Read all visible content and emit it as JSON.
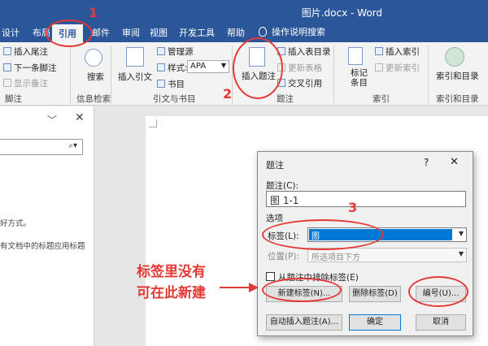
{
  "window": {
    "title": "图片.docx  -  Word"
  },
  "tabs": [
    "设计",
    "布局",
    "引用",
    "邮件",
    "审阅",
    "视图",
    "开发工具",
    "帮助"
  ],
  "tell_me": "操作说明搜索",
  "ribbon": {
    "footnotes": {
      "insert_endnote": "插入尾注",
      "next_footnote": "下一条脚注",
      "show_notes": "显示备注",
      "group": "脚注"
    },
    "research": {
      "search": "搜索",
      "group": "信息检索"
    },
    "citations": {
      "insert_citation": "插入引文",
      "manage_sources": "管理源",
      "style_label": "样式:",
      "style_value": "APA",
      "bibliography": "书目",
      "group": "引文与书目"
    },
    "captions": {
      "insert_caption": "插入题注",
      "insert_table_of_figures": "插入表目录",
      "update_table": "更新表格",
      "cross_reference": "交叉引用",
      "group": "题注"
    },
    "index": {
      "mark_entry": "标记条目",
      "insert_index": "插入索引",
      "update_index": "更新索引",
      "group": "索引"
    },
    "toa": {
      "group": "索引和目录"
    }
  },
  "nav_pane": {
    "text1": "好方式。",
    "text2": "有文档中的标题应用标题"
  },
  "dialog": {
    "title": "题注",
    "help": "?",
    "close": "✕",
    "caption_label": "题注(C):",
    "caption_value": "图 1-1",
    "options_label": "选项",
    "label_label": "标签(L):",
    "label_value": "图",
    "position_label": "位置(P):",
    "position_value": "所选项目下方",
    "exclude_label": "从题注中排除标签(E)",
    "new_label_btn": "新建标签(N)...",
    "delete_label_btn": "删除标签(D)",
    "numbering_btn": "编号(U)...",
    "autocaption_btn": "自动插入题注(A)...",
    "ok_btn": "确定",
    "cancel_btn": "取消"
  },
  "annotations": {
    "step1": "1",
    "step2": "2",
    "step3": "3",
    "note_line1": "标签里没有",
    "note_line2": "可在此新建"
  },
  "colors": {
    "word_blue": "#2b579a",
    "annotation_red": "#e53935",
    "selection_blue": "#0078d7"
  }
}
